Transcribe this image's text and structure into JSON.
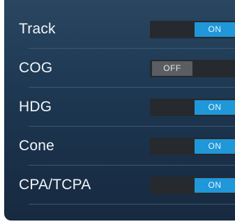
{
  "settings": {
    "rows": [
      {
        "label": "Track",
        "state_text": "ON",
        "on": true
      },
      {
        "label": "COG",
        "state_text": "OFF",
        "on": false
      },
      {
        "label": "HDG",
        "state_text": "ON",
        "on": true
      },
      {
        "label": "Cone",
        "state_text": "ON",
        "on": true
      },
      {
        "label": "CPA/TCPA",
        "state_text": "ON",
        "on": true
      }
    ]
  },
  "colors": {
    "toggle_on": "#1f97d8",
    "toggle_off": "#5a5e63",
    "toggle_track": "#26292d",
    "panel_bg": "#1f3a54"
  }
}
